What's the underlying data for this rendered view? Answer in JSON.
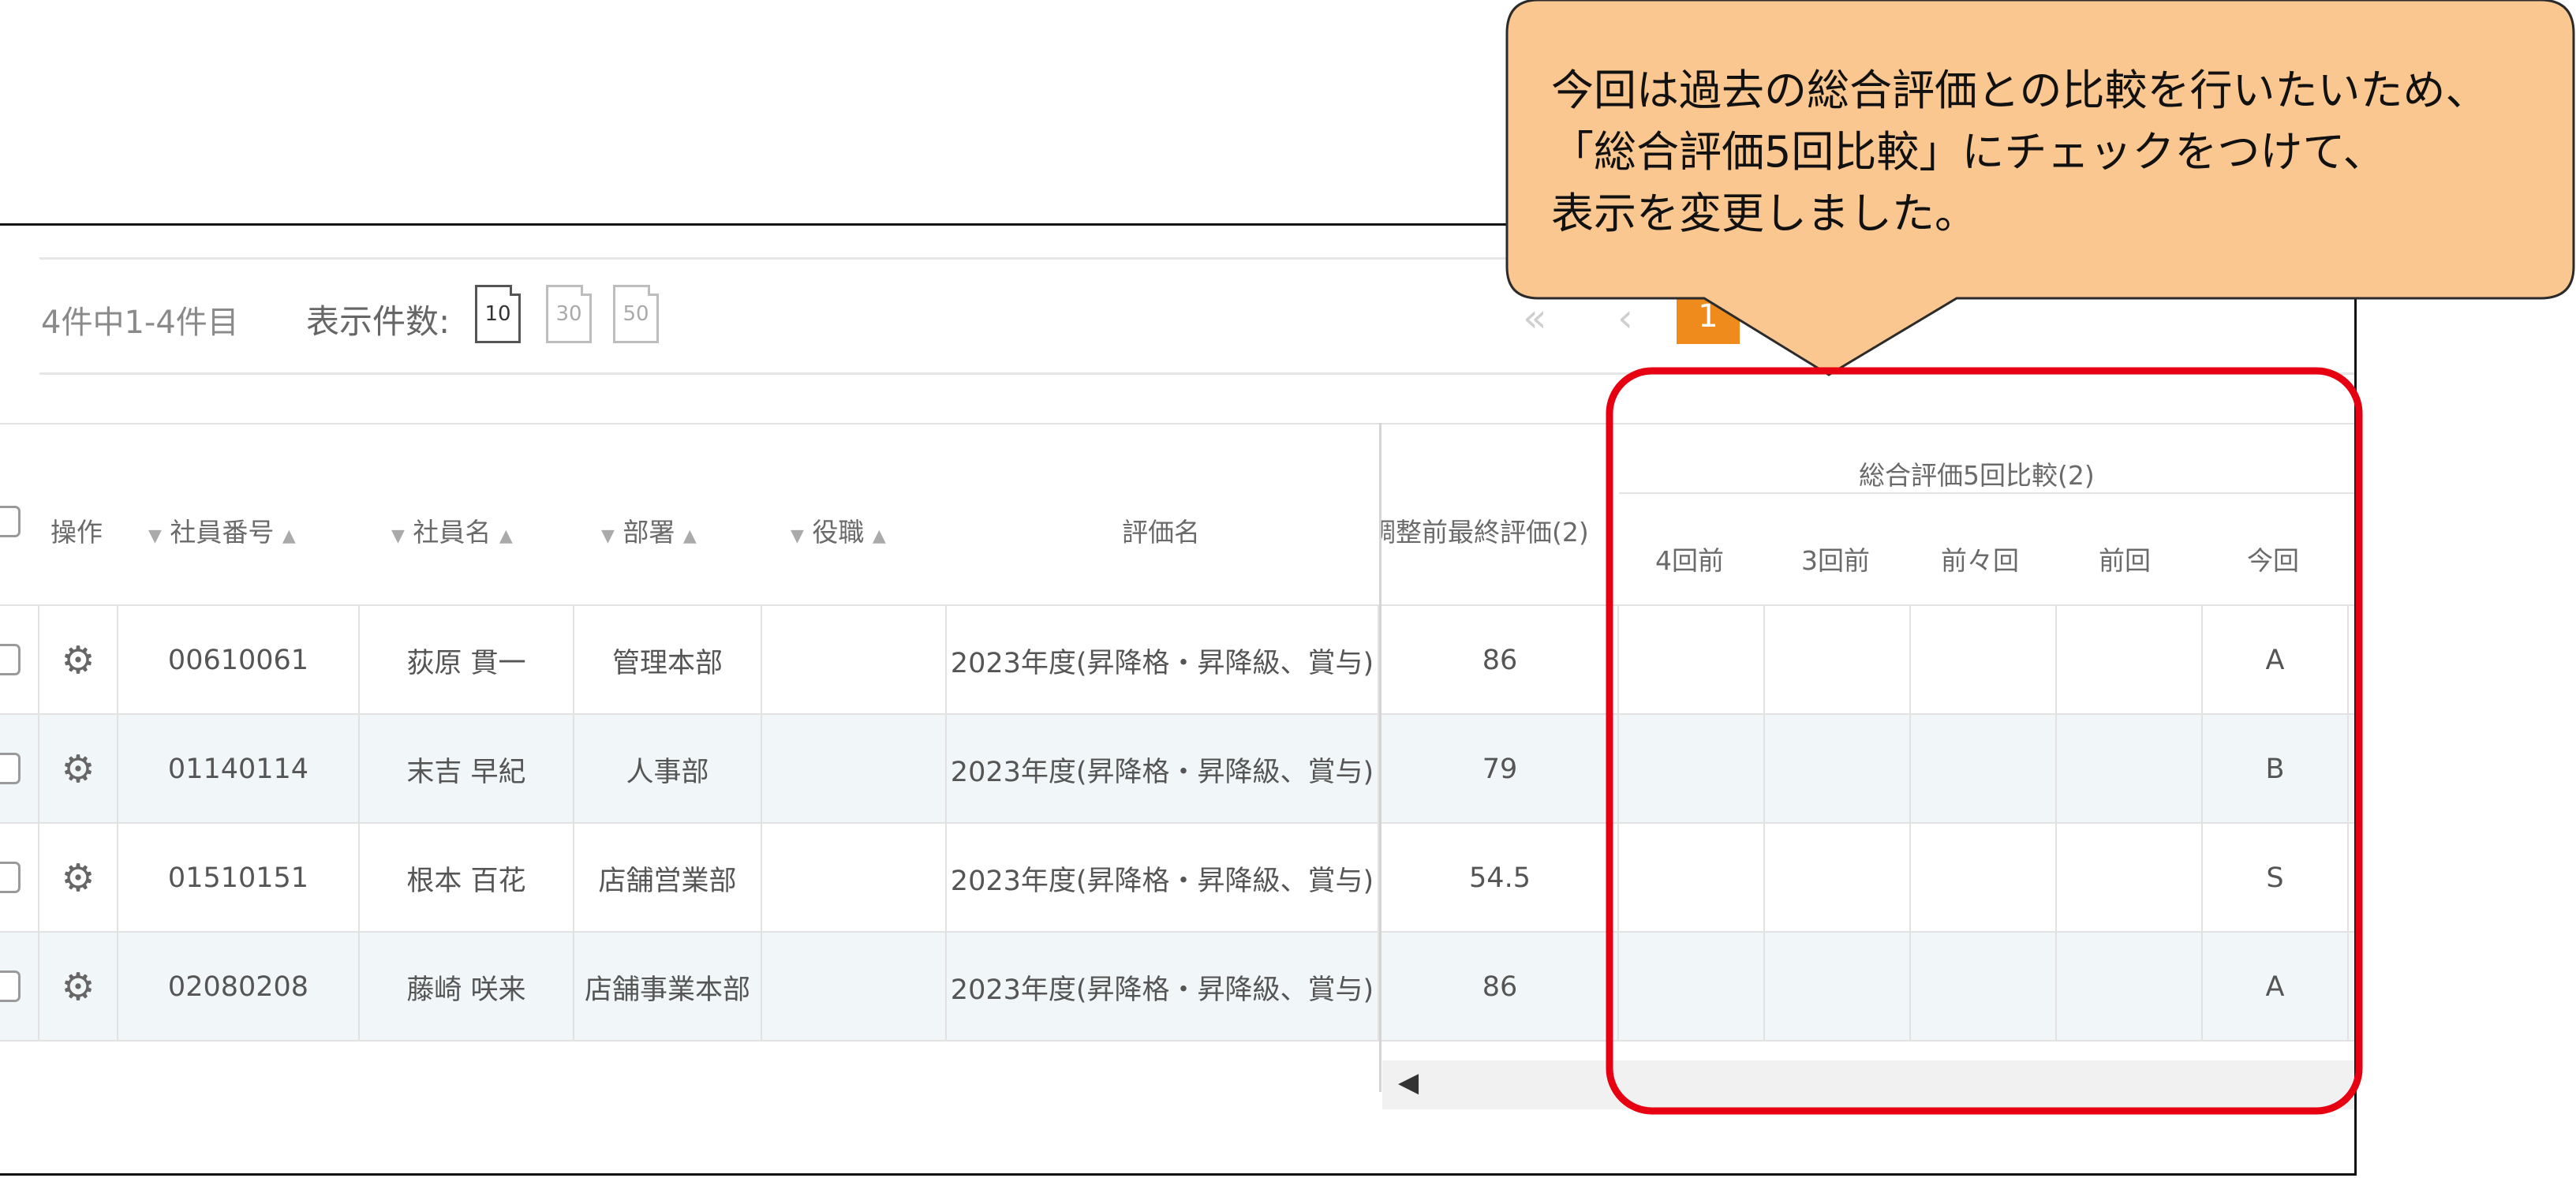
{
  "pager": {
    "summary": "4件中1-4件目",
    "per_page_label": "表示件数:",
    "per_page_options": [
      "10",
      "30",
      "50"
    ],
    "current_page": "1",
    "first_icon": "double-chevron-left-icon",
    "prev_icon": "chevron-left-icon"
  },
  "table": {
    "headers": {
      "actions": "操作",
      "employee_no": "社員番号",
      "employee_name": "社員名",
      "department": "部署",
      "position": "役職",
      "evaluation_name": "評価名",
      "final_eval": "調整前最終評価(2)",
      "comparison_group": "総合評価5回比較(2)",
      "comparison": [
        "4回前",
        "3回前",
        "前々回",
        "前回",
        "今回"
      ]
    },
    "rows": [
      {
        "employee_no": "00610061",
        "employee_name": "荻原 貫一",
        "department": "管理本部",
        "position": "",
        "evaluation_name": "2023年度(昇降格・昇降級、賞与)",
        "final_eval": "86",
        "comparison": [
          "",
          "",
          "",
          "",
          "A"
        ]
      },
      {
        "employee_no": "01140114",
        "employee_name": "末吉 早紀",
        "department": "人事部",
        "position": "",
        "evaluation_name": "2023年度(昇降格・昇降級、賞与)",
        "final_eval": "79",
        "comparison": [
          "",
          "",
          "",
          "",
          "B"
        ]
      },
      {
        "employee_no": "01510151",
        "employee_name": "根本 百花",
        "department": "店舗営業部",
        "position": "",
        "evaluation_name": "2023年度(昇降格・昇降級、賞与)",
        "final_eval": "54.5",
        "comparison": [
          "",
          "",
          "",
          "",
          "S"
        ]
      },
      {
        "employee_no": "02080208",
        "employee_name": "藤崎 咲来",
        "department": "店舗事業本部",
        "position": "",
        "evaluation_name": "2023年度(昇降格・昇降級、賞与)",
        "final_eval": "86",
        "comparison": [
          "",
          "",
          "",
          "",
          "A"
        ]
      }
    ]
  },
  "callout": {
    "lines": [
      "今回は過去の総合評価との比較を行いたいため、",
      "「総合評価5回比較」にチェックをつけて、",
      "表示を変更しました。"
    ],
    "fill_color": "#fbc791",
    "highlight_color": "#e60012"
  }
}
